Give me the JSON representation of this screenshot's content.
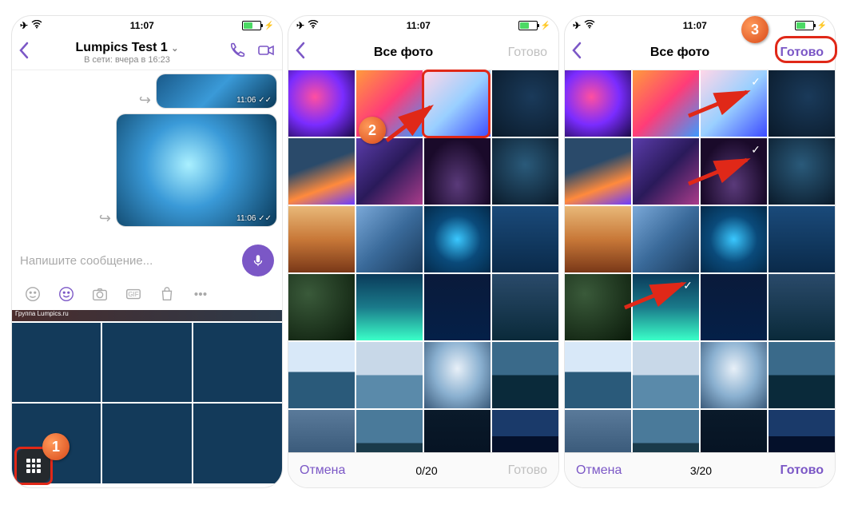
{
  "status": {
    "time": "11:07"
  },
  "phone1": {
    "nav": {
      "title": "Lumpics Test 1",
      "subtitle": "В сети: вчера в 16:23"
    },
    "msg_ts1": "11:06 ✓✓",
    "msg_ts2": "11:06 ✓✓",
    "input_placeholder": "Напишите сообщение...",
    "gallery_header": "Группа Lumpics.ru"
  },
  "phone2": {
    "nav": {
      "title": "Все фото",
      "done": "Готово"
    },
    "bottom": {
      "cancel": "Отмена",
      "count": "0/20",
      "done": "Готово"
    }
  },
  "phone3": {
    "nav": {
      "title": "Все фото",
      "done": "Готово"
    },
    "bottom": {
      "cancel": "Отмена",
      "count": "3/20",
      "done": "Готово"
    }
  },
  "markers": {
    "m1": "1",
    "m2": "2",
    "m3": "3"
  }
}
